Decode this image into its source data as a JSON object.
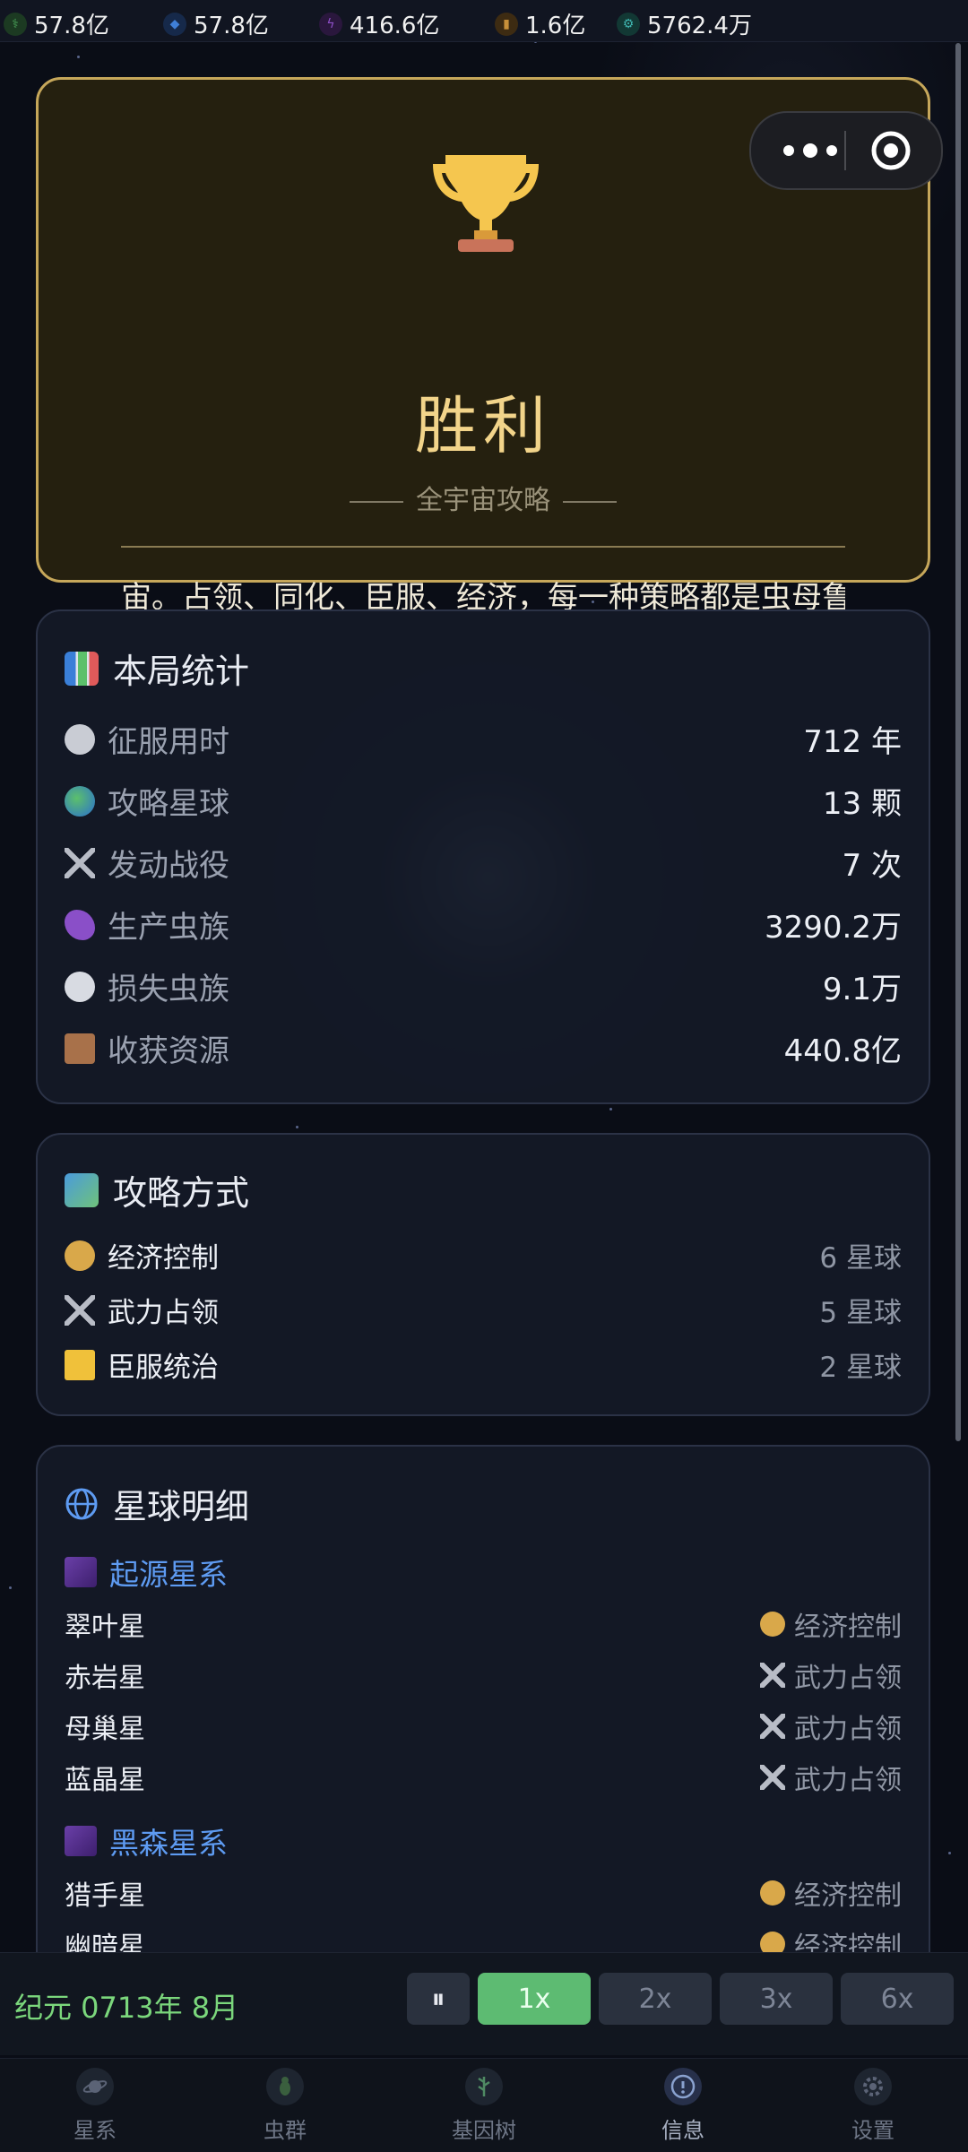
{
  "resources": [
    {
      "icon": "dna-icon",
      "value": "57.8亿",
      "color": "#4aa35a"
    },
    {
      "icon": "gem-icon",
      "value": "57.8亿",
      "color": "#3f7fd8"
    },
    {
      "icon": "energy-icon",
      "value": "416.6亿",
      "color": "#8e4fc8"
    },
    {
      "icon": "gold-icon",
      "value": "1.6亿",
      "color": "#c8903a"
    },
    {
      "icon": "gear-icon",
      "value": "5762.4万",
      "color": "#3fb5b0"
    }
  ],
  "victory": {
    "title": "胜利",
    "subtitle": "全宇宙攻略",
    "description": "宙。占领、同化、臣服、经济，每一种策略都是虫母鲁"
  },
  "stats": {
    "title": "本局统计",
    "rows": [
      {
        "label": "征服用时",
        "value": "712 年",
        "icon": "stopwatch-icon"
      },
      {
        "label": "攻略星球",
        "value": "13 颗",
        "icon": "globe-icon"
      },
      {
        "label": "发动战役",
        "value": "7 次",
        "icon": "crossed-swords-icon"
      },
      {
        "label": "生产虫族",
        "value": "3290.2万",
        "icon": "worm-icon"
      },
      {
        "label": "损失虫族",
        "value": "9.1万",
        "icon": "skull-icon"
      },
      {
        "label": "收获资源",
        "value": "440.8亿",
        "icon": "package-icon"
      }
    ]
  },
  "methods": {
    "title": "攻略方式",
    "rows": [
      {
        "label": "经济控制",
        "value": "6 星球",
        "icon": "money-bag-icon"
      },
      {
        "label": "武力占领",
        "value": "5 星球",
        "icon": "crossed-swords-icon"
      },
      {
        "label": "臣服统治",
        "value": "2 星球",
        "icon": "crown-icon"
      }
    ]
  },
  "planets": {
    "title": "星球明细",
    "galaxies": [
      {
        "name": "起源星系",
        "planets": [
          {
            "name": "翠叶星",
            "method": "经济控制"
          },
          {
            "name": "赤岩星",
            "method": "武力占领"
          },
          {
            "name": "母巢星",
            "method": "武力占领"
          },
          {
            "name": "蓝晶星",
            "method": "武力占领"
          }
        ]
      },
      {
        "name": "黑森星系",
        "planets": [
          {
            "name": "猎手星",
            "method": "经济控制"
          },
          {
            "name": "幽暗星",
            "method": "经济控制"
          }
        ]
      }
    ]
  },
  "controls": {
    "era": "纪元 0713年 8月",
    "pause": "⏸",
    "speeds": [
      "1x",
      "2x",
      "3x",
      "6x"
    ]
  },
  "tabs": [
    {
      "label": "星系",
      "icon": "planet-icon"
    },
    {
      "label": "虫群",
      "icon": "bug-icon"
    },
    {
      "label": "基因树",
      "icon": "gene-tree-icon"
    },
    {
      "label": "信息",
      "icon": "info-icon"
    },
    {
      "label": "设置",
      "icon": "settings-icon"
    }
  ]
}
